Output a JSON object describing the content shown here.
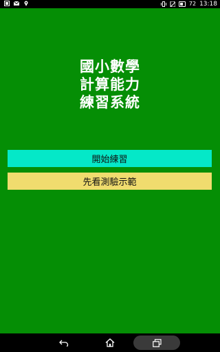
{
  "status_bar": {
    "time": "13:18",
    "battery_level": "72",
    "battery_fraction": 0.72,
    "icons": [
      "notification-icon",
      "mail-icon",
      "location-icon",
      "vibrate-icon",
      "no-sim-icon",
      "battery-icon"
    ]
  },
  "app": {
    "background_color": "#058E05",
    "title_lines": [
      "國小數學",
      "計算能力",
      "練習系統"
    ],
    "buttons": {
      "start_label": "開始練習",
      "start_color": "#05E8C8",
      "demo_label": "先看測驗示範",
      "demo_color": "#F0DC6E"
    }
  },
  "nav_bar": {
    "icons": [
      "back-icon",
      "home-icon",
      "recent-apps-icon"
    ]
  }
}
